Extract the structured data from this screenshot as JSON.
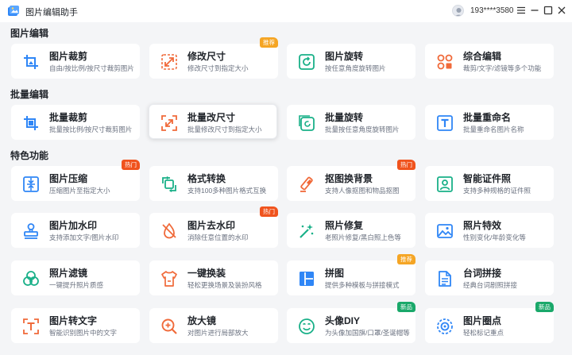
{
  "app": {
    "title": "图片编辑助手",
    "user": "193****3580"
  },
  "sections": [
    {
      "title": "图片编辑"
    },
    {
      "title": "批量编辑"
    },
    {
      "title": "特色功能"
    }
  ],
  "badges": {
    "hot": "热门",
    "recommend": "推荐",
    "new": "新品"
  },
  "cards": {
    "crop": {
      "title": "图片裁剪",
      "desc": "自由/按比例/按尺寸裁剪图片"
    },
    "resize": {
      "title": "修改尺寸",
      "desc": "修改尺寸到指定大小"
    },
    "rotate": {
      "title": "图片旋转",
      "desc": "按任意角度旋转图片"
    },
    "combo": {
      "title": "综合编辑",
      "desc": "裁剪/文字/滤镜等多个功能"
    },
    "batch_crop": {
      "title": "批量裁剪",
      "desc": "批量按比例/按尺寸裁剪图片"
    },
    "batch_resize": {
      "title": "批量改尺寸",
      "desc": "批量修改尺寸到指定大小"
    },
    "batch_rotate": {
      "title": "批量旋转",
      "desc": "批量按任意角度旋转图片"
    },
    "batch_rename": {
      "title": "批量重命名",
      "desc": "批量重命名图片名称"
    },
    "compress": {
      "title": "图片压缩",
      "desc": "压缩图片至指定大小"
    },
    "convert": {
      "title": "格式转换",
      "desc": "支持100多种图片格式互换"
    },
    "cutout": {
      "title": "抠图换背景",
      "desc": "支持人像抠图和物品抠图"
    },
    "idphoto": {
      "title": "智能证件照",
      "desc": "支持多种规格的证件照"
    },
    "watermark_add": {
      "title": "图片加水印",
      "desc": "支持添加文字/图片水印"
    },
    "watermark_remove": {
      "title": "图片去水印",
      "desc": "消除任意位置的水印"
    },
    "restore": {
      "title": "照片修复",
      "desc": "老照片修复/黑白照上色等"
    },
    "effects": {
      "title": "照片特效",
      "desc": "性别变化/年龄变化等"
    },
    "filter": {
      "title": "照片滤镜",
      "desc": "一键提升照片质感"
    },
    "outfit": {
      "title": "一键换装",
      "desc": "轻松更换场景及装扮风格"
    },
    "collage": {
      "title": "拼图",
      "desc": "提供多种模板与拼接模式"
    },
    "caption": {
      "title": "台词拼接",
      "desc": "经典台词剧照拼接"
    },
    "ocr": {
      "title": "图片转文字",
      "desc": "智能识别图片中的文字"
    },
    "magnifier": {
      "title": "放大镜",
      "desc": "对图片进行局部放大"
    },
    "avatar_diy": {
      "title": "头像DIY",
      "desc": "为头像加国旗/口罩/圣诞帽等"
    },
    "circle": {
      "title": "图片圈点",
      "desc": "轻松标记重点"
    }
  }
}
